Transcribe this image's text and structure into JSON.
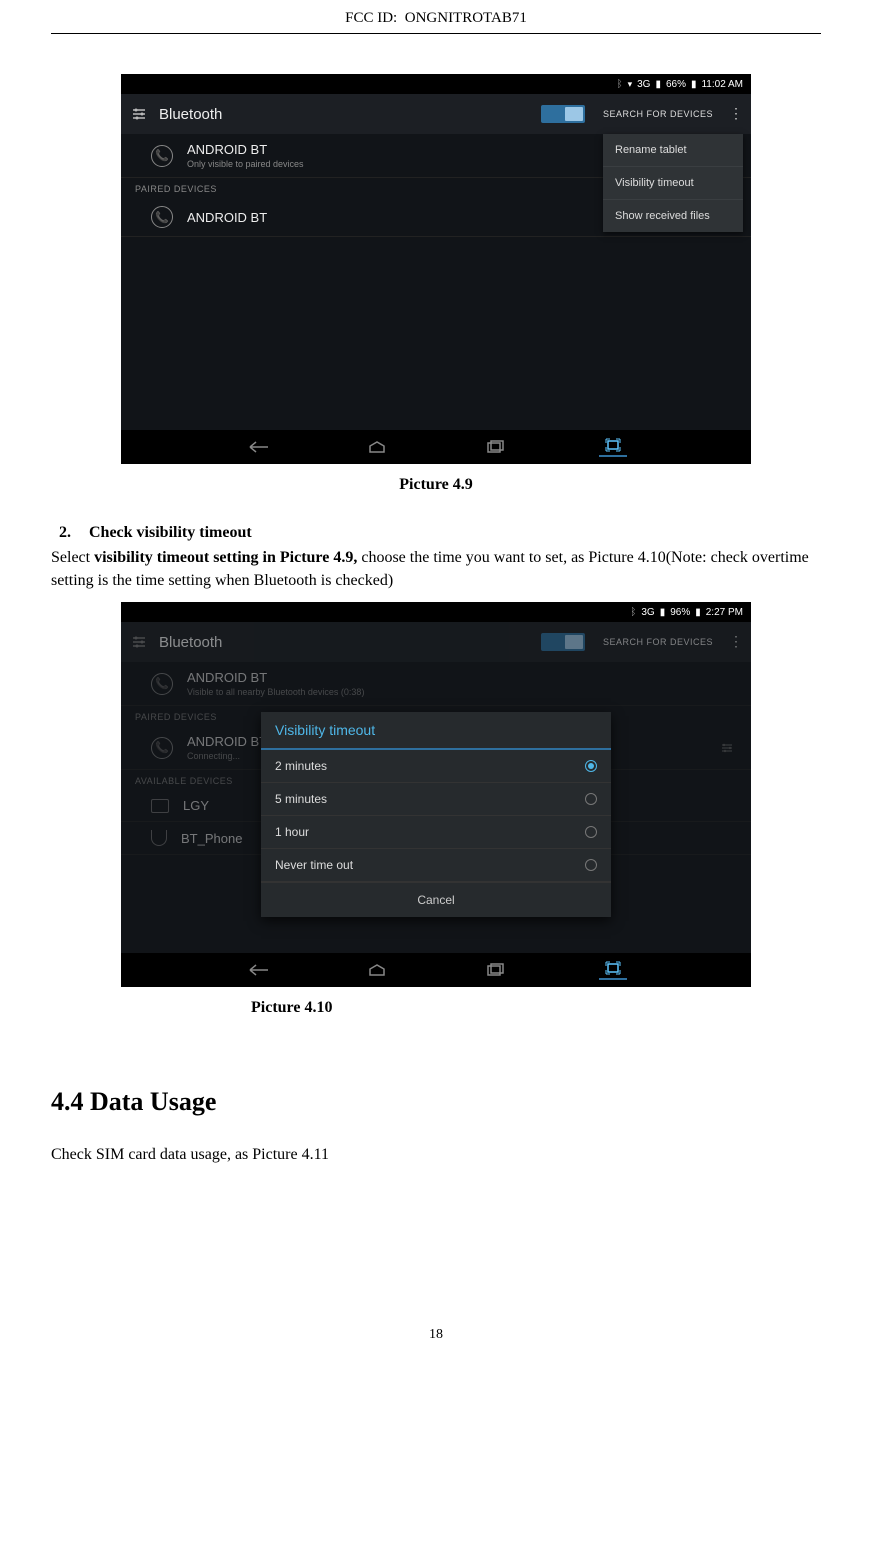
{
  "header": {
    "fcc_id_label": "FCC ID:",
    "fcc_id_value": "ONGNITROTAB71"
  },
  "screenshot1": {
    "status": {
      "signal": "3G",
      "battery": "66%",
      "time": "11:02 AM"
    },
    "title": "Bluetooth",
    "search_label": "SEARCH FOR DEVICES",
    "device": {
      "name": "ANDROID BT",
      "sub": "Only visible to paired devices"
    },
    "paired_label": "PAIRED DEVICES",
    "paired_device": "ANDROID BT",
    "menu": {
      "item1": "Rename tablet",
      "item2": "Visibility timeout",
      "item3": "Show received files"
    }
  },
  "caption1": "Picture 4.9",
  "step": {
    "num": "2.",
    "head": "Check visibility timeout",
    "before_bold": "Select ",
    "bold": "visibility timeout setting in Picture 4.9,",
    "after_bold": " choose the time you want to set, as Picture 4.10(Note: check overtime setting is the time setting when Bluetooth is checked)"
  },
  "screenshot2": {
    "status": {
      "signal": "3G",
      "battery": "96%",
      "time": "2:27 PM"
    },
    "title": "Bluetooth",
    "search_label": "SEARCH FOR DEVICES",
    "device": {
      "name": "ANDROID BT",
      "sub": "Visible to all nearby Bluetooth devices (0:38)"
    },
    "paired_label": "PAIRED DEVICES",
    "paired_device": {
      "name": "ANDROID BT",
      "sub": "Connecting..."
    },
    "available_label": "AVAILABLE DEVICES",
    "available1": "LGY",
    "available2": "BT_Phone",
    "dialog": {
      "title": "Visibility timeout",
      "opt1": "2 minutes",
      "opt2": "5 minutes",
      "opt3": "1 hour",
      "opt4": "Never time out",
      "cancel": "Cancel"
    }
  },
  "caption2": "Picture 4.10",
  "section": {
    "heading": "4.4 Data Usage",
    "text": "Check SIM card data usage, as Picture 4.11"
  },
  "page_number": "18"
}
